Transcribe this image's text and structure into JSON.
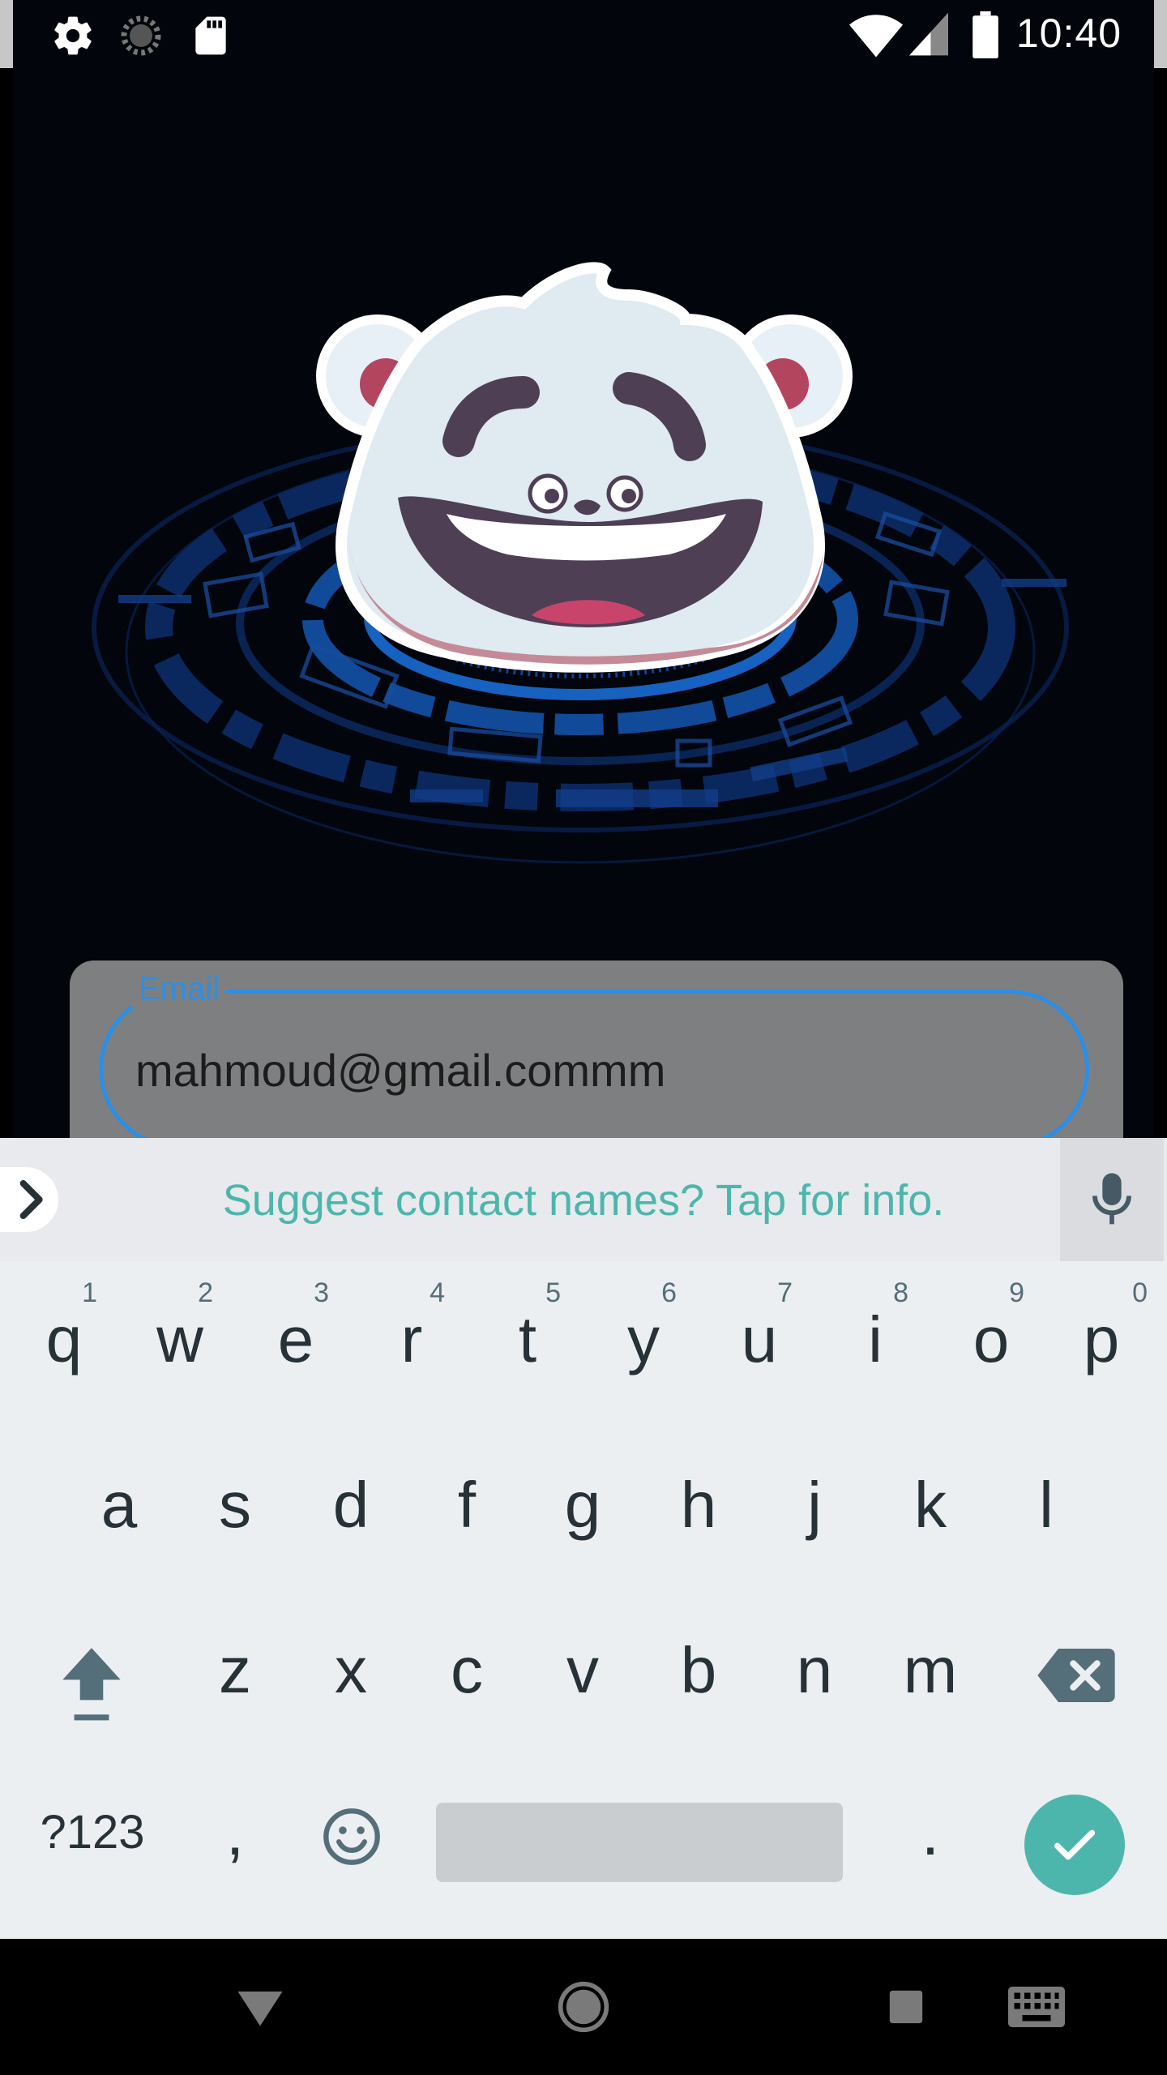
{
  "status_bar": {
    "time": "10:40",
    "left_icons": [
      "settings-icon",
      "loading-icon",
      "sd-card-icon"
    ],
    "right_icons": [
      "wifi-icon",
      "signal-icon",
      "battery-icon"
    ]
  },
  "form": {
    "email_label": "Email",
    "email_value": "mahmoud@gmail.commm",
    "accent_color": "#2b8fe6"
  },
  "keyboard": {
    "suggestion": "Suggest contact names? Tap for info.",
    "row1": [
      {
        "key": "q",
        "hint": "1"
      },
      {
        "key": "w",
        "hint": "2"
      },
      {
        "key": "e",
        "hint": "3"
      },
      {
        "key": "r",
        "hint": "4"
      },
      {
        "key": "t",
        "hint": "5"
      },
      {
        "key": "y",
        "hint": "6"
      },
      {
        "key": "u",
        "hint": "7"
      },
      {
        "key": "i",
        "hint": "8"
      },
      {
        "key": "o",
        "hint": "9"
      },
      {
        "key": "p",
        "hint": "0"
      }
    ],
    "row2": [
      "a",
      "s",
      "d",
      "f",
      "g",
      "h",
      "j",
      "k",
      "l"
    ],
    "row3": [
      "z",
      "x",
      "c",
      "v",
      "b",
      "n",
      "m"
    ],
    "symbols_label": "?123",
    "comma": ",",
    "period": ".",
    "accent_color": "#4db6ac"
  },
  "nav_bar": {
    "buttons": [
      "back-icon",
      "home-icon",
      "recents-icon",
      "keyboard-switch-icon"
    ]
  }
}
